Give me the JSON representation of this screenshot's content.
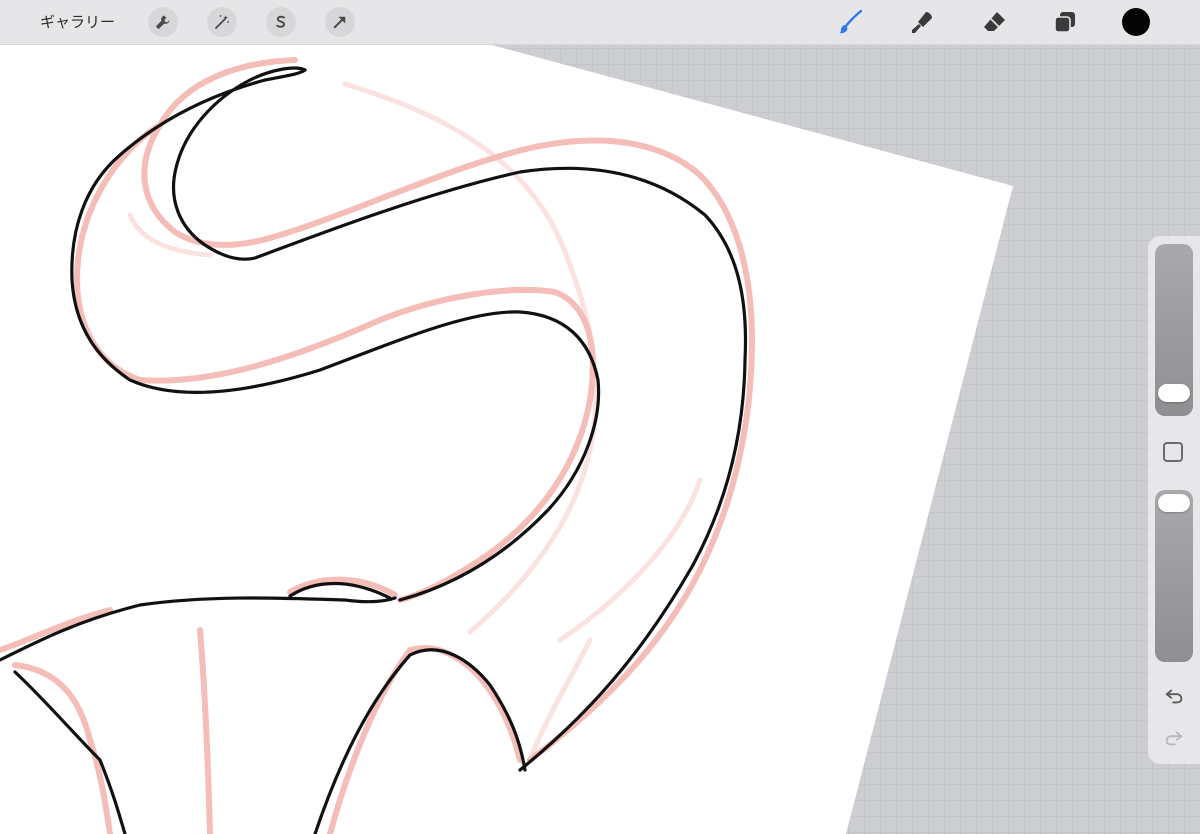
{
  "topbar": {
    "gallery_label": "ギャラリー",
    "left_tools": [
      {
        "name": "wrench-icon"
      },
      {
        "name": "magic-wand-icon"
      },
      {
        "name": "selection-s-icon"
      },
      {
        "name": "arrow-transform-icon"
      }
    ],
    "right_tools": [
      {
        "name": "brush-icon",
        "active": true
      },
      {
        "name": "smudge-icon"
      },
      {
        "name": "eraser-icon"
      },
      {
        "name": "layers-icon"
      }
    ],
    "current_color": "#050505",
    "active_color": "#2f7ae5"
  },
  "sidebar": {
    "brush_size_level": 0.15,
    "opacity_level": 0.95,
    "icons": [
      "modify-square-icon",
      "undo-icon",
      "redo-icon"
    ]
  },
  "colors": {
    "toolbar_bg": "#e6e6e8",
    "paper": "#ffffff",
    "sketch_black": "#111111",
    "sketch_pink": "#f4bdb8"
  }
}
